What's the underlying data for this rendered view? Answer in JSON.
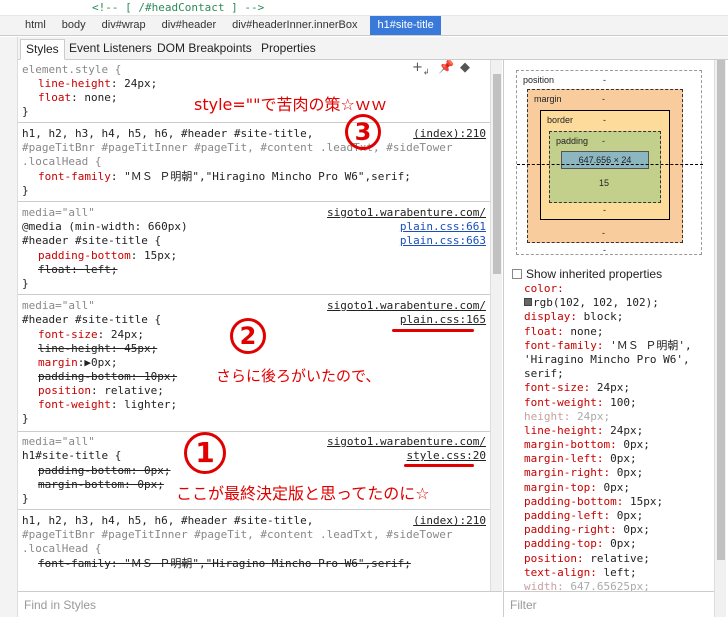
{
  "source_line": "<!-- [ /#headContact ] -->",
  "breadcrumbs": [
    "html",
    "body",
    "div#wrap",
    "div#header",
    "div#headerInner.innerBox",
    "h1#site-title"
  ],
  "tabs": [
    "Styles",
    "Event Listeners",
    "DOM Breakpoints",
    "Properties"
  ],
  "rules": {
    "r1": {
      "selector": "element.style {",
      "props": [
        [
          "line-height",
          "24px;"
        ],
        [
          "float",
          "none;"
        ]
      ],
      "close": "}"
    },
    "r2": {
      "sel1": "h1, h2, h3, h4, h5, h6, #header #site-title,",
      "sel2": "#pageTitBnr #pageTitInner #pageTit, #content .leadTxt, #sideTower",
      "sel3": ".localHead {",
      "src": "(index):210",
      "prop": "font-family",
      "val": "\"ＭＳ Ｐ明朝\",\"Hiragino Mincho Pro W6\",serif;",
      "close": "}"
    },
    "r3": {
      "media": "media=\"all\"",
      "media2": "@media (min-width: 660px)",
      "selector": "#header #site-title {",
      "src_top": "sigoto1.warabenture.com/",
      "src_a": "plain.css:661",
      "src_b": "plain.css:663",
      "p1": "padding-bottom",
      "v1": "15px;",
      "p2": "float: left;",
      "close": "}"
    },
    "r4": {
      "media": "media=\"all\"",
      "selector": "#header #site-title {",
      "src_top": "sigoto1.warabenture.com/",
      "src": "plain.css:165",
      "font_size": "font-size",
      "font_size_v": "24px;",
      "line_height": "line-height: 45px;",
      "margin": "margin",
      "margin_v": "0px;",
      "padding_bottom": "padding-bottom: 10px;",
      "position": "position",
      "position_v": "relative;",
      "font_weight": "font-weight",
      "font_weight_v": "lighter;",
      "close": "}"
    },
    "r5": {
      "media": "media=\"all\"",
      "selector": "h1#site-title {",
      "src_top": "sigoto1.warabenture.com/",
      "src": "style.css:20",
      "p1": "padding-bottom: 0px;",
      "p2": "margin-bottom: 0px;",
      "close": "}"
    },
    "r6": {
      "sel1": "h1, h2, h3, h4, h5, h6, #header #site-title,",
      "sel2": "#pageTitBnr #pageTitInner #pageTit, #content .leadTxt, #sideTower",
      "sel3": ".localHead {",
      "src": "(index):210",
      "strike": "font-family: \"ＭＳ Ｐ明朝\",\"Hiragino Mincho Pro W6\",serif;"
    }
  },
  "annotations": {
    "a3_text": "style=\"\"で苦肉の策☆ｗｗ",
    "a3_num": "3",
    "a2_num": "2",
    "a2_text": "さらに後ろがいたので、",
    "a1_num": "1",
    "a1_text": "ここが最終決定版と思ってたのに☆"
  },
  "box_model": {
    "position_label": "position",
    "position_val": "-",
    "margin_label": "margin",
    "margin_val": "-",
    "border_label": "border",
    "border_val": "-",
    "padding_label": "padding",
    "padding_val": "-",
    "content": "647.656 × 24",
    "padding_bottom": "15",
    "dash": "-"
  },
  "show_inherited": "Show inherited properties",
  "computed": [
    [
      "color:",
      "",
      true
    ],
    [
      "",
      "rgb(102, 102, 102);",
      true
    ],
    [
      "display:",
      " block;",
      true
    ],
    [
      "float:",
      " none;",
      true
    ],
    [
      "font-family:",
      " 'ＭＳ Ｐ明朝',",
      true
    ],
    [
      "",
      "'Hiragino Mincho Pro W6',",
      true
    ],
    [
      "",
      "serif;",
      true
    ],
    [
      "font-size:",
      " 24px;",
      true
    ],
    [
      "font-weight:",
      " 100;",
      true
    ],
    [
      "height:",
      " 24px;",
      false
    ],
    [
      "line-height:",
      " 24px;",
      true
    ],
    [
      "margin-bottom:",
      " 0px;",
      true
    ],
    [
      "margin-left:",
      " 0px;",
      true
    ],
    [
      "margin-right:",
      " 0px;",
      true
    ],
    [
      "margin-top:",
      " 0px;",
      true
    ],
    [
      "padding-bottom:",
      " 15px;",
      true
    ],
    [
      "padding-left:",
      " 0px;",
      true
    ],
    [
      "padding-right:",
      " 0px;",
      true
    ],
    [
      "padding-top:",
      " 0px;",
      true
    ],
    [
      "position:",
      " relative;",
      true
    ],
    [
      "text-align:",
      " left;",
      true
    ],
    [
      "width:",
      " 647.65625px;",
      false
    ]
  ],
  "find_placeholder": "Find in Styles",
  "filter_placeholder": "Filter",
  "colors": {
    "accent": "#3879d9",
    "annotation": "#e00000",
    "prop": "#c80000",
    "swatch": "#666666"
  }
}
